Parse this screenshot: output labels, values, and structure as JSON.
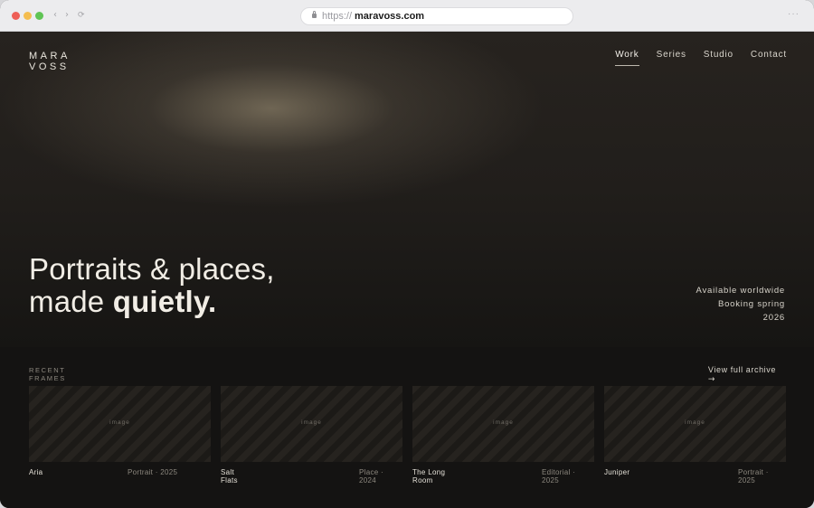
{
  "browser": {
    "url_scheme": "https://",
    "url_host": "maravoss.com",
    "nav_back": "‹",
    "nav_forward": "›",
    "nav_reload": "⟳",
    "more": "···"
  },
  "site": {
    "logo_line1": "MARA",
    "logo_line2": "VOSS"
  },
  "nav": {
    "items": [
      {
        "label": "Work",
        "active": true
      },
      {
        "label": "Series",
        "active": false
      },
      {
        "label": "Studio",
        "active": false
      },
      {
        "label": "Contact",
        "active": false
      }
    ]
  },
  "hero": {
    "headline_line1": "Portraits & places,",
    "headline_line2_plain": "made ",
    "headline_line2_bold": "quietly.",
    "availability": [
      "Available worldwide",
      "Booking spring",
      "2026"
    ]
  },
  "recent": {
    "label_line1": "RECENT",
    "label_line2": "FRAMES",
    "archive_link": "View full archive",
    "archive_arrow": "→",
    "items": [
      {
        "image_label": "image",
        "title": "Aria",
        "meta": "Portrait · 2025"
      },
      {
        "image_label": "image",
        "title": "Salt Flats",
        "meta": "Place · 2024"
      },
      {
        "image_label": "image",
        "title": "The Long Room",
        "meta": "Editorial · 2025"
      },
      {
        "image_label": "image",
        "title": "Juniper",
        "meta": "Portrait · 2025"
      }
    ]
  },
  "colors": {
    "background": "#151412",
    "text_primary": "#f1ede5",
    "text_muted": "#8d887f"
  }
}
